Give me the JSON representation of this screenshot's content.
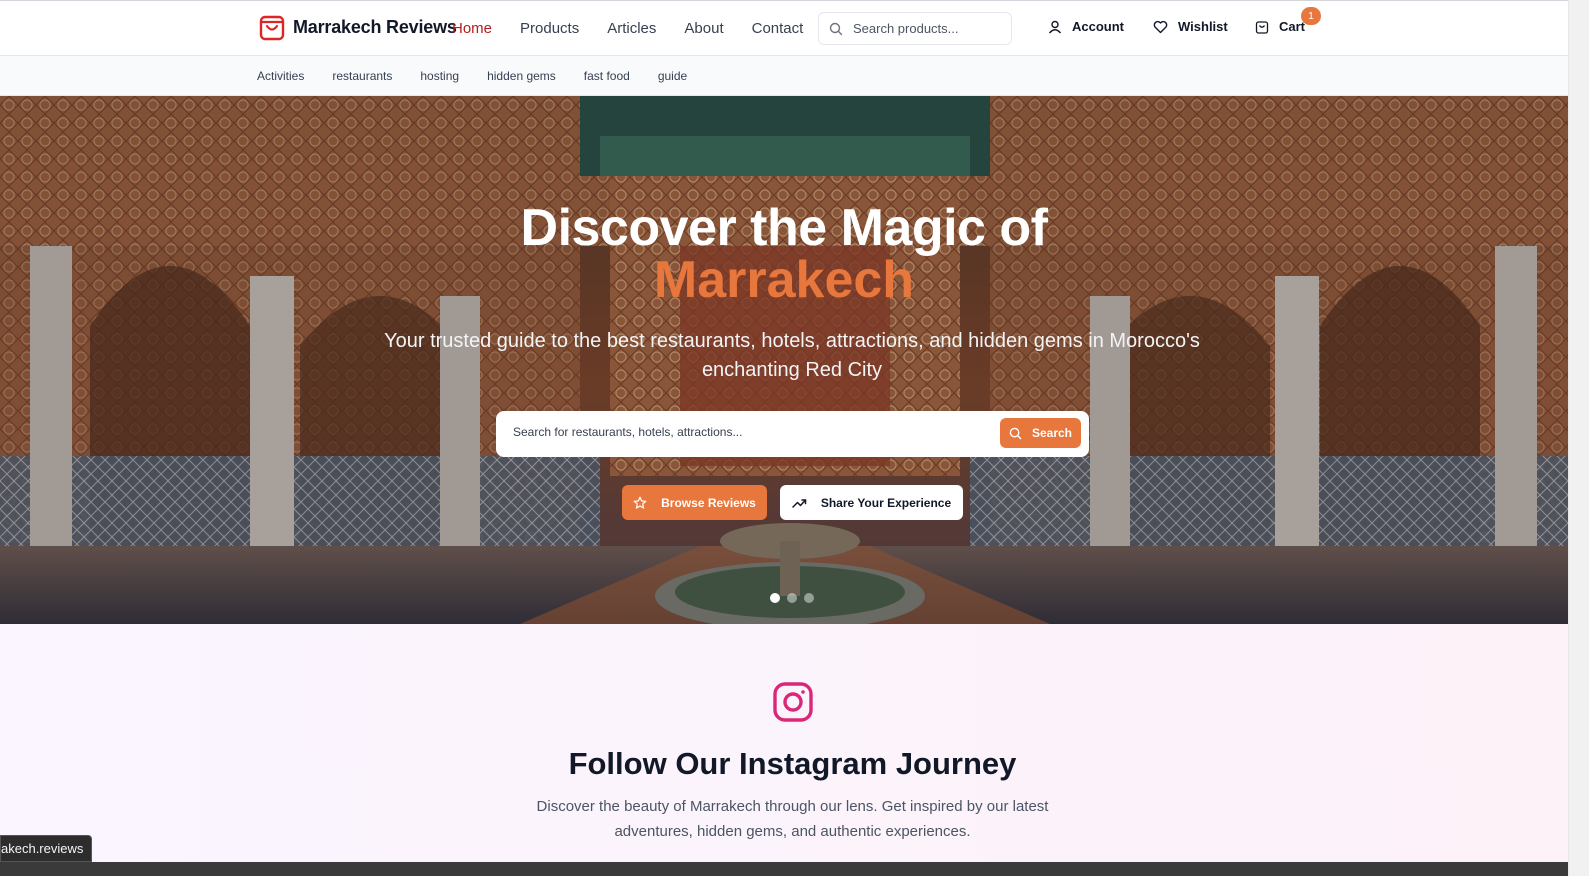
{
  "header": {
    "brand": "Marrakech Reviews",
    "nav": [
      {
        "label": "Home",
        "active": true
      },
      {
        "label": "Products",
        "active": false
      },
      {
        "label": "Articles",
        "active": false
      },
      {
        "label": "About",
        "active": false
      },
      {
        "label": "Contact",
        "active": false
      }
    ],
    "search_placeholder": "Search products...",
    "account_label": "Account",
    "wishlist_label": "Wishlist",
    "cart_label": "Cart",
    "cart_count": "1"
  },
  "subnav": [
    "Activities",
    "restaurants",
    "hosting",
    "hidden gems",
    "fast food",
    "guide"
  ],
  "hero": {
    "title_line1": "Discover the Magic of",
    "title_line2": "Marrakech",
    "subtitle": "Your trusted guide to the best restaurants, hotels, attractions, and hidden gems in Morocco's enchanting Red City",
    "search_placeholder": "Search for restaurants, hotels, attractions...",
    "search_button": "Search",
    "browse_button": "Browse Reviews",
    "share_button": "Share Your Experience",
    "slide_count": 3,
    "active_slide": 1
  },
  "instagram": {
    "title": "Follow Our Instagram Journey",
    "text": "Discover the beauty of Marrakech through our lens. Get inspired by our latest adventures, hidden gems, and authentic experiences."
  },
  "status_url": "akech.reviews",
  "colors": {
    "accent": "#e8773d",
    "brand_red": "#dc2626",
    "active_nav": "#b91c1c",
    "instagram_pink": "#db2777"
  }
}
